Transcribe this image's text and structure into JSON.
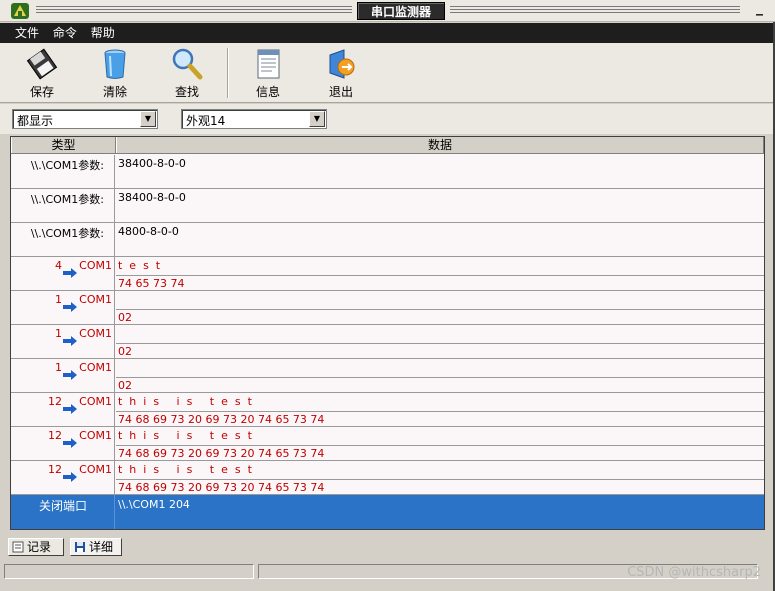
{
  "window": {
    "title": "串口监测器",
    "minimize_glyph": "_"
  },
  "menu": {
    "items": [
      "文件",
      "命令",
      "帮助"
    ]
  },
  "toolbar": {
    "save": "保存",
    "clear": "清除",
    "find": "查找",
    "info": "信息",
    "exit": "退出",
    "icons": {
      "save": "floppy-disk-icon",
      "clear": "trash-bin-icon",
      "find": "magnifier-icon",
      "info": "document-icon",
      "exit": "exit-icon"
    }
  },
  "filters": {
    "display": "都显示",
    "appearance": "外观14"
  },
  "grid": {
    "headers": {
      "type": "类型",
      "data": "数据"
    },
    "rows": [
      {
        "kind": "info",
        "type": "\\\\.\\COM1参数:",
        "data": "38400-8-0-0"
      },
      {
        "kind": "info",
        "type": "\\\\.\\COM1参数:",
        "data": "38400-8-0-0"
      },
      {
        "kind": "info",
        "type": "\\\\.\\COM1参数:",
        "data": "4800-8-0-0"
      },
      {
        "kind": "io",
        "count": "4",
        "port": "COM1",
        "ascii": "t  e  s  t",
        "hex": "74 65 73 74"
      },
      {
        "kind": "io",
        "count": "1",
        "port": "COM1",
        "ascii": "",
        "hex": "02"
      },
      {
        "kind": "io",
        "count": "1",
        "port": "COM1",
        "ascii": "",
        "hex": "02"
      },
      {
        "kind": "io",
        "count": "1",
        "port": "COM1",
        "ascii": "",
        "hex": "02"
      },
      {
        "kind": "io",
        "count": "12",
        "port": "COM1",
        "ascii": "t  h  i  s     i  s     t  e  s  t",
        "hex": "74 68 69 73 20 69 73 20 74 65 73 74"
      },
      {
        "kind": "io",
        "count": "12",
        "port": "COM1",
        "ascii": "t  h  i  s     i  s     t  e  s  t",
        "hex": "74 68 69 73 20 69 73 20 74 65 73 74"
      },
      {
        "kind": "io",
        "count": "12",
        "port": "COM1",
        "ascii": "t  h  i  s     i  s     t  e  s  t",
        "hex": "74 68 69 73 20 69 73 20 74 65 73 74"
      }
    ],
    "selected": {
      "type": "关闭端口",
      "data": "\\\\.\\COM1 204"
    }
  },
  "tabs": {
    "record": "记录",
    "detail": "详细"
  },
  "watermark": "CSDN @withcsharp2",
  "colors": {
    "selection": "#2a73c6",
    "io_text": "#c00000",
    "arrow": "#1f5fc8"
  }
}
